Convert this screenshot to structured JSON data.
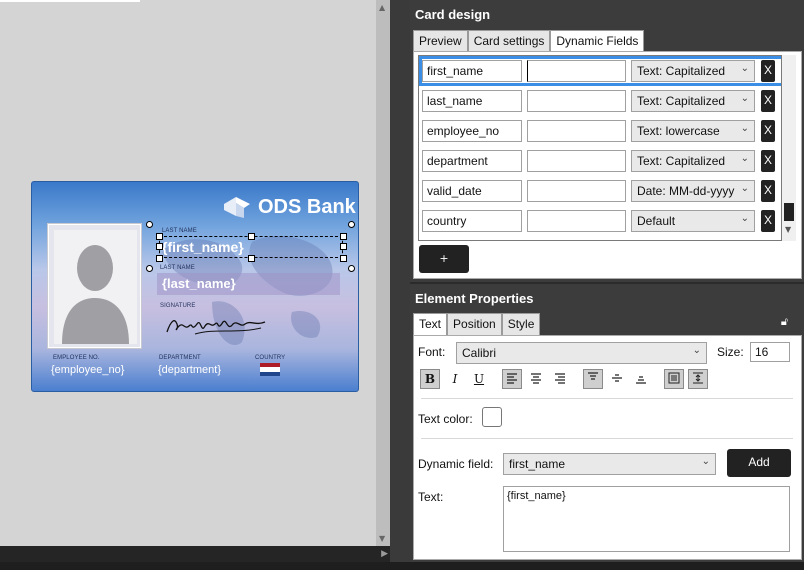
{
  "colors": {
    "accent_select": "#3a8ee6",
    "panel_header": "#3c3c3c",
    "canvas": "#d4d4d4",
    "button_dark": "#222222"
  },
  "card": {
    "brand": "ODS Bank",
    "logo_icon": "ods-cube-logo",
    "first_name_caption": "LAST NAME",
    "first_name_value": "{first_name}",
    "last_name_caption": "LAST NAME",
    "last_name_value": "{last_name}",
    "signature_caption": "SIGNATURE",
    "employee_caption": "EMPLOYEE NO.",
    "employee_value": "{employee_no}",
    "department_caption": "DEPARTMENT",
    "department_value": "{department}",
    "country_caption": "COUNTRY"
  },
  "card_design": {
    "title": "Card design",
    "tabs": [
      "Preview",
      "Card settings",
      "Dynamic Fields"
    ],
    "active_tab": "Dynamic Fields",
    "fields": [
      {
        "name": "first_name",
        "value": "",
        "format": "Text: Capitalized"
      },
      {
        "name": "last_name",
        "value": "",
        "format": "Text: Capitalized"
      },
      {
        "name": "employee_no",
        "value": "",
        "format": "Text: lowercase"
      },
      {
        "name": "department",
        "value": "",
        "format": "Text: Capitalized"
      },
      {
        "name": "valid_date",
        "value": "",
        "format": "Date: MM-dd-yyyy"
      },
      {
        "name": "country",
        "value": "",
        "format": "Default"
      }
    ],
    "remove_label": "X",
    "add_label": "+"
  },
  "element_properties": {
    "title": "Element Properties",
    "tabs": [
      "Text",
      "Position",
      "Style"
    ],
    "active_tab": "Text",
    "font_label": "Font:",
    "font_value": "Calibri",
    "size_label": "Size:",
    "size_value": "16",
    "format_buttons": [
      "B",
      "I",
      "U"
    ],
    "text_color_label": "Text color:",
    "dynamic_field_label": "Dynamic field:",
    "dynamic_field_value": "first_name",
    "add_label": "Add",
    "text_label": "Text:",
    "text_value": "{first_name}"
  }
}
